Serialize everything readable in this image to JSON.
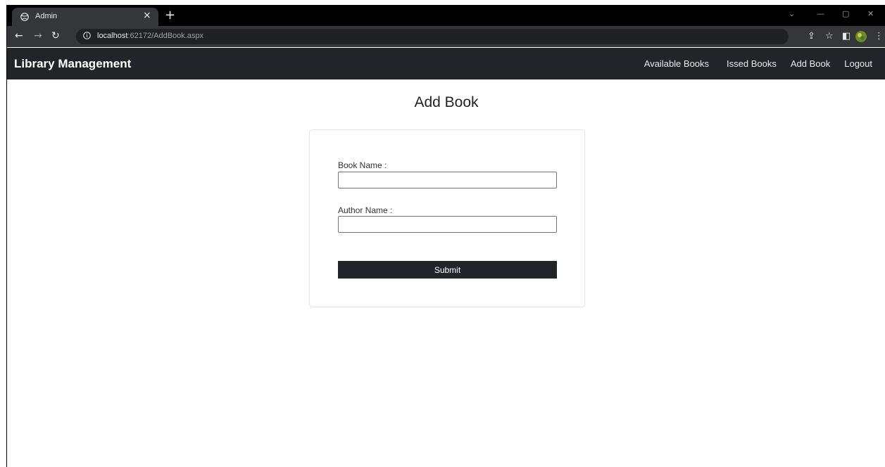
{
  "browser": {
    "tab_title": "Admin",
    "tab_close": "×",
    "new_tab": "+",
    "url_host": "localhost",
    "url_rest": ":62172/AddBook.aspx",
    "window_minimize": "—",
    "window_maximize": "▢",
    "window_close": "✕",
    "window_chevron": "⌄"
  },
  "navbar": {
    "brand": "Library Management",
    "links": [
      "Available Books",
      "Issed Books",
      "Add Book",
      "Logout"
    ]
  },
  "page": {
    "title": "Add Book"
  },
  "form": {
    "book_name_label": "Book Name :",
    "book_name_value": "",
    "author_name_label": "Author Name :",
    "author_name_value": "",
    "submit_label": "Submit"
  },
  "colors": {
    "navbar_bg": "#212529",
    "button_bg": "#212529",
    "tab_strip": "#000000",
    "toolbar": "#35363a"
  }
}
